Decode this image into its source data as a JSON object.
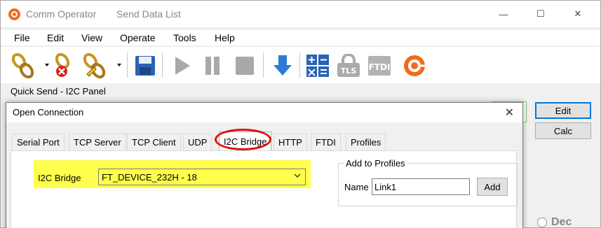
{
  "window": {
    "app_name": "Comm Operator",
    "document_name": "Send Data List",
    "minimize_glyph": "—",
    "maximize_glyph": "☐",
    "close_glyph": "✕"
  },
  "menu": [
    "File",
    "Edit",
    "View",
    "Operate",
    "Tools",
    "Help"
  ],
  "toolbar": {
    "icons": [
      "connect-chain-icon",
      "disconnect-chain-icon",
      "edit-chain-icon",
      "save-disk-icon",
      "play-icon",
      "pause-icon",
      "stop-icon",
      "download-arrow-icon",
      "calculator-icon",
      "tls-lock-icon",
      "ftdi-icon",
      "comm-operator-logo-icon"
    ],
    "labels": {
      "tls": "TLS",
      "ftdi": "FTDI"
    }
  },
  "quick_send": {
    "panel_label": "Quick Send - I2C Panel"
  },
  "side_buttons": {
    "edit": "Edit",
    "calc": "Calc"
  },
  "radio": {
    "dec_label": "Dec"
  },
  "dialog": {
    "title": "Open Connection",
    "close_glyph": "✕",
    "tabs": [
      "Serial Port",
      "TCP Server",
      "TCP Client",
      "UDP",
      "I2C Bridge",
      "HTTP",
      "FTDI",
      "Profiles"
    ],
    "active_tab": "I2C Bridge",
    "i2c_bridge_label": "I2C Bridge",
    "i2c_bridge_value": "FT_DEVICE_232H - 18",
    "add_to_profiles": {
      "group_title": "Add to Profiles",
      "name_label": "Name",
      "name_value": "Link1",
      "add_button": "Add"
    }
  },
  "colors": {
    "highlight_yellow": "#ffff4d",
    "annotation_red": "#e01010",
    "accent_blue": "#0078d7",
    "logo_orange": "#f26b1d"
  }
}
